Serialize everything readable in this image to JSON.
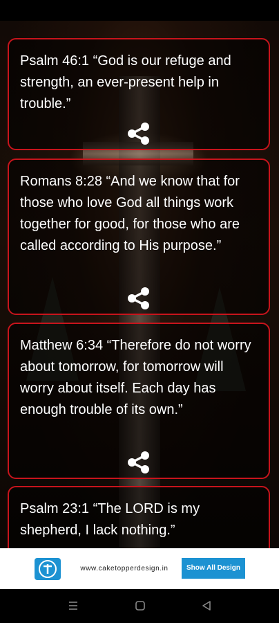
{
  "verses": [
    {
      "text": "Psalm 46:1 “God is our refuge and strength, an ever-present help in trouble.”"
    },
    {
      "text": "Romans 8:28 “And we know that for those who love God all things work together for good, for those who are called according to His purpose.”"
    },
    {
      "text": "Matthew 6:34 “Therefore do not worry about tomorrow, for tomorrow will worry about itself. Each day has enough trouble of its own.”"
    },
    {
      "text": "Psalm 23:1 “The LORD is my shepherd, I lack nothing.”"
    }
  ],
  "ad": {
    "url": "www.caketopperdesign.in",
    "button_label": "Show All Design"
  },
  "colors": {
    "card_border": "#c8141c",
    "ad_accent": "#1c92d2"
  },
  "icons": {
    "share": "share-icon",
    "logo": "t-logo-icon",
    "nav_menu": "menu-icon",
    "nav_home": "home-icon",
    "nav_back": "back-icon"
  }
}
